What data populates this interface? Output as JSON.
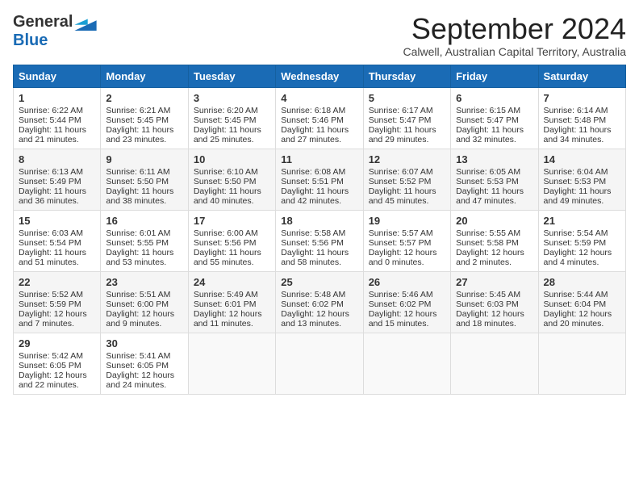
{
  "logo": {
    "general": "General",
    "blue": "Blue"
  },
  "title": "September 2024",
  "location": "Calwell, Australian Capital Territory, Australia",
  "weekdays": [
    "Sunday",
    "Monday",
    "Tuesday",
    "Wednesday",
    "Thursday",
    "Friday",
    "Saturday"
  ],
  "weeks": [
    [
      {
        "day": "1",
        "sunrise": "Sunrise: 6:22 AM",
        "sunset": "Sunset: 5:44 PM",
        "daylight": "Daylight: 11 hours and 21 minutes."
      },
      {
        "day": "2",
        "sunrise": "Sunrise: 6:21 AM",
        "sunset": "Sunset: 5:45 PM",
        "daylight": "Daylight: 11 hours and 23 minutes."
      },
      {
        "day": "3",
        "sunrise": "Sunrise: 6:20 AM",
        "sunset": "Sunset: 5:45 PM",
        "daylight": "Daylight: 11 hours and 25 minutes."
      },
      {
        "day": "4",
        "sunrise": "Sunrise: 6:18 AM",
        "sunset": "Sunset: 5:46 PM",
        "daylight": "Daylight: 11 hours and 27 minutes."
      },
      {
        "day": "5",
        "sunrise": "Sunrise: 6:17 AM",
        "sunset": "Sunset: 5:47 PM",
        "daylight": "Daylight: 11 hours and 29 minutes."
      },
      {
        "day": "6",
        "sunrise": "Sunrise: 6:15 AM",
        "sunset": "Sunset: 5:47 PM",
        "daylight": "Daylight: 11 hours and 32 minutes."
      },
      {
        "day": "7",
        "sunrise": "Sunrise: 6:14 AM",
        "sunset": "Sunset: 5:48 PM",
        "daylight": "Daylight: 11 hours and 34 minutes."
      }
    ],
    [
      {
        "day": "8",
        "sunrise": "Sunrise: 6:13 AM",
        "sunset": "Sunset: 5:49 PM",
        "daylight": "Daylight: 11 hours and 36 minutes."
      },
      {
        "day": "9",
        "sunrise": "Sunrise: 6:11 AM",
        "sunset": "Sunset: 5:50 PM",
        "daylight": "Daylight: 11 hours and 38 minutes."
      },
      {
        "day": "10",
        "sunrise": "Sunrise: 6:10 AM",
        "sunset": "Sunset: 5:50 PM",
        "daylight": "Daylight: 11 hours and 40 minutes."
      },
      {
        "day": "11",
        "sunrise": "Sunrise: 6:08 AM",
        "sunset": "Sunset: 5:51 PM",
        "daylight": "Daylight: 11 hours and 42 minutes."
      },
      {
        "day": "12",
        "sunrise": "Sunrise: 6:07 AM",
        "sunset": "Sunset: 5:52 PM",
        "daylight": "Daylight: 11 hours and 45 minutes."
      },
      {
        "day": "13",
        "sunrise": "Sunrise: 6:05 AM",
        "sunset": "Sunset: 5:53 PM",
        "daylight": "Daylight: 11 hours and 47 minutes."
      },
      {
        "day": "14",
        "sunrise": "Sunrise: 6:04 AM",
        "sunset": "Sunset: 5:53 PM",
        "daylight": "Daylight: 11 hours and 49 minutes."
      }
    ],
    [
      {
        "day": "15",
        "sunrise": "Sunrise: 6:03 AM",
        "sunset": "Sunset: 5:54 PM",
        "daylight": "Daylight: 11 hours and 51 minutes."
      },
      {
        "day": "16",
        "sunrise": "Sunrise: 6:01 AM",
        "sunset": "Sunset: 5:55 PM",
        "daylight": "Daylight: 11 hours and 53 minutes."
      },
      {
        "day": "17",
        "sunrise": "Sunrise: 6:00 AM",
        "sunset": "Sunset: 5:56 PM",
        "daylight": "Daylight: 11 hours and 55 minutes."
      },
      {
        "day": "18",
        "sunrise": "Sunrise: 5:58 AM",
        "sunset": "Sunset: 5:56 PM",
        "daylight": "Daylight: 11 hours and 58 minutes."
      },
      {
        "day": "19",
        "sunrise": "Sunrise: 5:57 AM",
        "sunset": "Sunset: 5:57 PM",
        "daylight": "Daylight: 12 hours and 0 minutes."
      },
      {
        "day": "20",
        "sunrise": "Sunrise: 5:55 AM",
        "sunset": "Sunset: 5:58 PM",
        "daylight": "Daylight: 12 hours and 2 minutes."
      },
      {
        "day": "21",
        "sunrise": "Sunrise: 5:54 AM",
        "sunset": "Sunset: 5:59 PM",
        "daylight": "Daylight: 12 hours and 4 minutes."
      }
    ],
    [
      {
        "day": "22",
        "sunrise": "Sunrise: 5:52 AM",
        "sunset": "Sunset: 5:59 PM",
        "daylight": "Daylight: 12 hours and 7 minutes."
      },
      {
        "day": "23",
        "sunrise": "Sunrise: 5:51 AM",
        "sunset": "Sunset: 6:00 PM",
        "daylight": "Daylight: 12 hours and 9 minutes."
      },
      {
        "day": "24",
        "sunrise": "Sunrise: 5:49 AM",
        "sunset": "Sunset: 6:01 PM",
        "daylight": "Daylight: 12 hours and 11 minutes."
      },
      {
        "day": "25",
        "sunrise": "Sunrise: 5:48 AM",
        "sunset": "Sunset: 6:02 PM",
        "daylight": "Daylight: 12 hours and 13 minutes."
      },
      {
        "day": "26",
        "sunrise": "Sunrise: 5:46 AM",
        "sunset": "Sunset: 6:02 PM",
        "daylight": "Daylight: 12 hours and 15 minutes."
      },
      {
        "day": "27",
        "sunrise": "Sunrise: 5:45 AM",
        "sunset": "Sunset: 6:03 PM",
        "daylight": "Daylight: 12 hours and 18 minutes."
      },
      {
        "day": "28",
        "sunrise": "Sunrise: 5:44 AM",
        "sunset": "Sunset: 6:04 PM",
        "daylight": "Daylight: 12 hours and 20 minutes."
      }
    ],
    [
      {
        "day": "29",
        "sunrise": "Sunrise: 5:42 AM",
        "sunset": "Sunset: 6:05 PM",
        "daylight": "Daylight: 12 hours and 22 minutes."
      },
      {
        "day": "30",
        "sunrise": "Sunrise: 5:41 AM",
        "sunset": "Sunset: 6:05 PM",
        "daylight": "Daylight: 12 hours and 24 minutes."
      },
      null,
      null,
      null,
      null,
      null
    ]
  ]
}
